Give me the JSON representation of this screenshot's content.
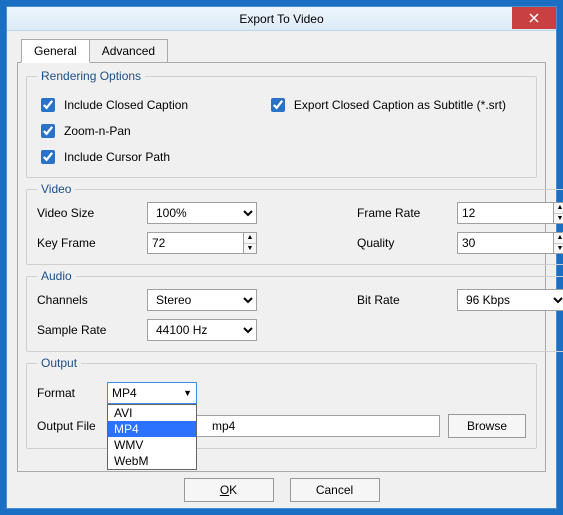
{
  "window": {
    "title": "Export To Video"
  },
  "tabs": {
    "general": "General",
    "advanced": "Advanced"
  },
  "rendering": {
    "legend": "Rendering Options",
    "include_cc": "Include Closed Caption",
    "export_cc_srt": "Export Closed Caption as Subtitle (*.srt)",
    "zoom_n_pan": "Zoom-n-Pan",
    "include_cursor": "Include Cursor Path"
  },
  "video": {
    "legend": "Video",
    "size_label": "Video Size",
    "size_value": "100%",
    "frame_rate_label": "Frame Rate",
    "frame_rate_value": "12",
    "key_frame_label": "Key Frame",
    "key_frame_value": "72",
    "quality_label": "Quality",
    "quality_value": "30"
  },
  "audio": {
    "legend": "Audio",
    "channels_label": "Channels",
    "channels_value": "Stereo",
    "bit_rate_label": "Bit Rate",
    "bit_rate_value": "96 Kbps",
    "sample_rate_label": "Sample Rate",
    "sample_rate_value": "44100 Hz"
  },
  "output": {
    "legend": "Output",
    "format_label": "Format",
    "format_value": "MP4",
    "options": {
      "avi": "AVI",
      "mp4": "MP4",
      "wmv": "WMV",
      "webm": "WebM"
    },
    "file_label": "Output File",
    "file_value_suffix": "mp4",
    "browse": "Browse"
  },
  "buttons": {
    "ok_pre": "",
    "ok_u": "O",
    "ok_post": "K",
    "cancel": "Cancel"
  }
}
